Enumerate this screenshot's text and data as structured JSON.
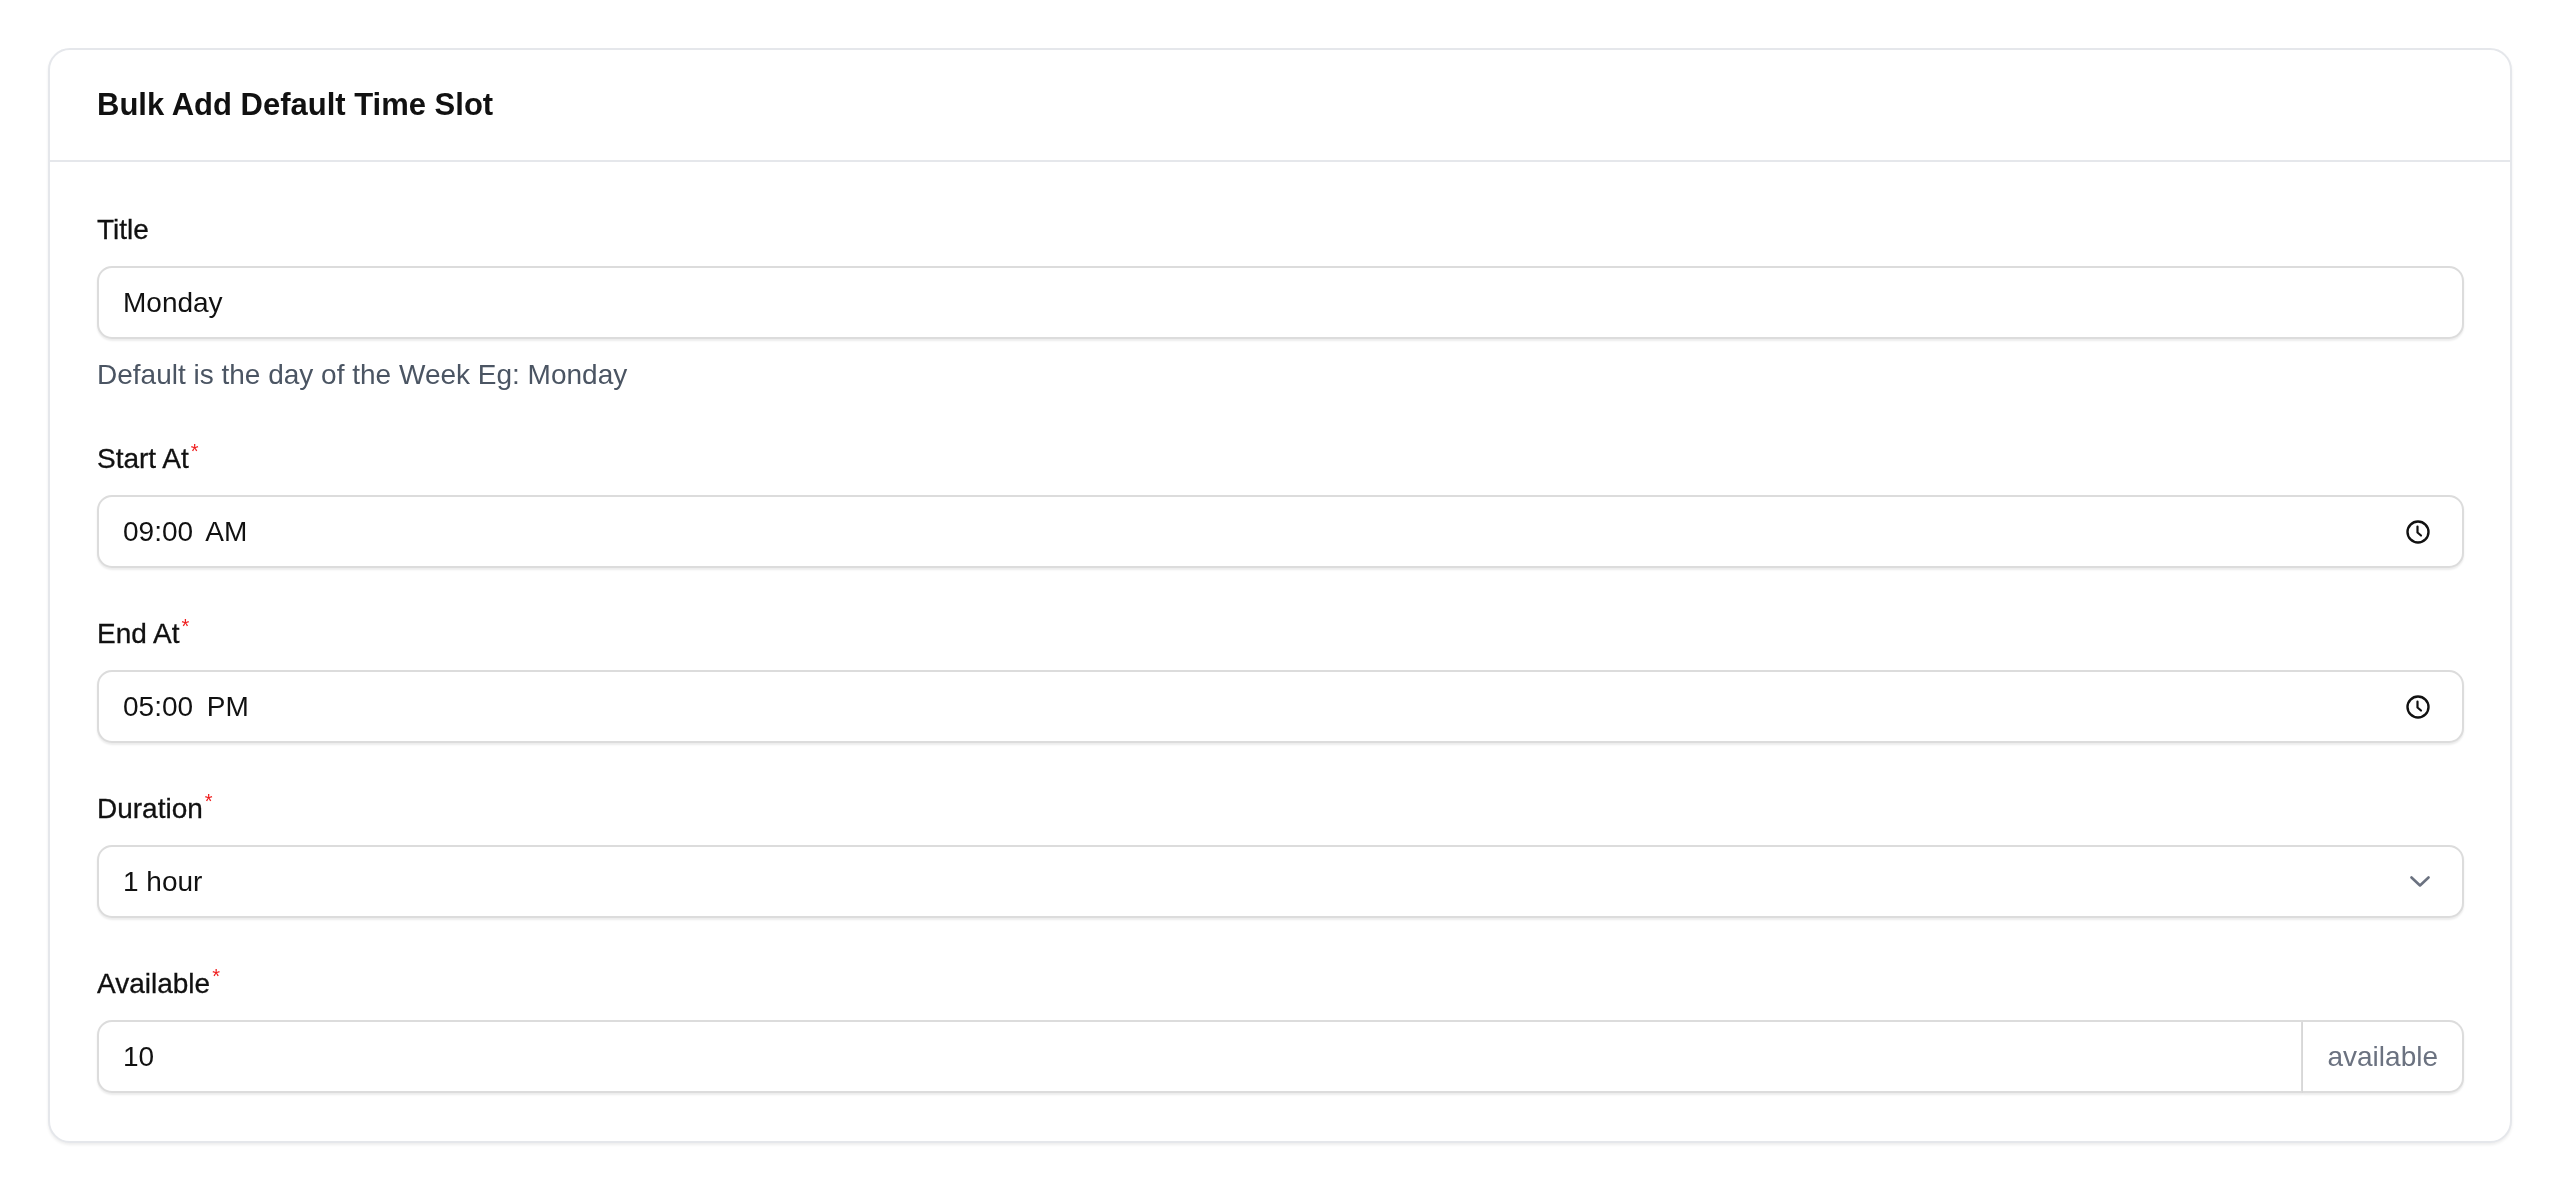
{
  "card": {
    "title": "Bulk Add Default Time Slot"
  },
  "fields": [
    {
      "kind": "text",
      "label": "Title",
      "value": "Monday",
      "helper": "Default is the day of the Week Eg: Monday"
    },
    {
      "kind": "time",
      "label": "Start At$^{*}$",
      "value": "09:00 AM"
    },
    {
      "kind": "time",
      "label": "End At$^{*}$",
      "value": "05:00 PM"
    },
    {
      "kind": "select",
      "label": "Duration$^{*}$",
      "value": "1 hour"
    },
    {
      "kind": "number",
      "label": "Available$^{*}$",
      "value": "10",
      "suffix": "available"
    }
  ]
}
